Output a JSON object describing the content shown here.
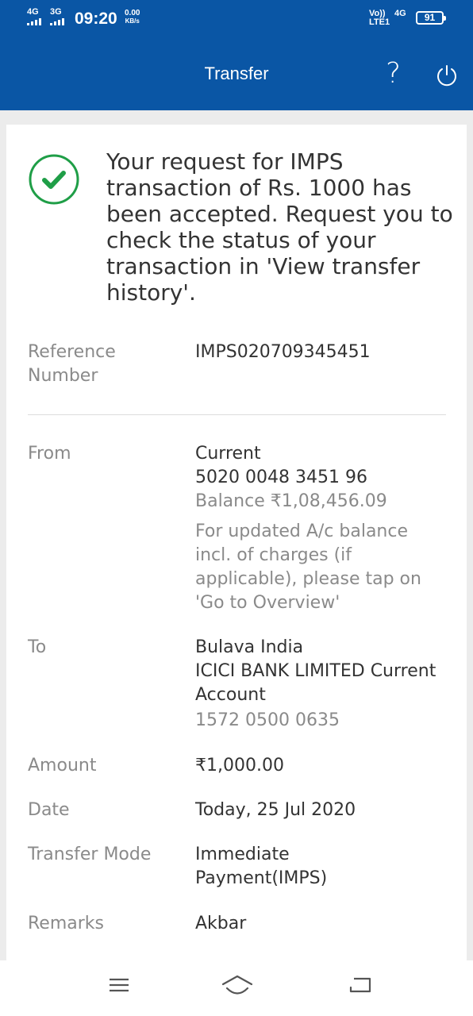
{
  "status_bar": {
    "sim1": "4G",
    "sim2": "3G",
    "time": "09:20",
    "speed_value": "0.00",
    "speed_unit": "KB/s",
    "volte": "Vo))",
    "lte": "LTE1",
    "network": "4G",
    "battery": "91"
  },
  "header": {
    "title": "Transfer",
    "help_glyph": "?"
  },
  "confirmation": {
    "message": "Your request for IMPS transaction of Rs. 1000 has been accepted. Request you to check the status of your transaction in 'View transfer history'."
  },
  "details": {
    "reference": {
      "label": "Reference Number",
      "value": "IMPS020709345451"
    },
    "from": {
      "label": "From",
      "account_type": "Current",
      "account_number": "5020 0048 3451 96",
      "balance": "Balance ₹1,08,456.09",
      "note": "For updated A/c balance incl. of charges (if applicable), please tap on 'Go to Overview'"
    },
    "to": {
      "label": "To",
      "name": "Bulava India",
      "bank": "ICICI BANK LIMITED Current Account",
      "account_number": "1572 0500 0635"
    },
    "amount": {
      "label": "Amount",
      "value": "₹1,000.00"
    },
    "date": {
      "label": "Date",
      "value": "Today, 25 Jul 2020"
    },
    "mode": {
      "label": "Transfer Mode",
      "value": "Immediate Payment(IMPS)"
    },
    "remarks": {
      "label": "Remarks",
      "value": "Akbar"
    }
  },
  "colors": {
    "brand": "#0a56a5",
    "success": "#1f9e47"
  }
}
